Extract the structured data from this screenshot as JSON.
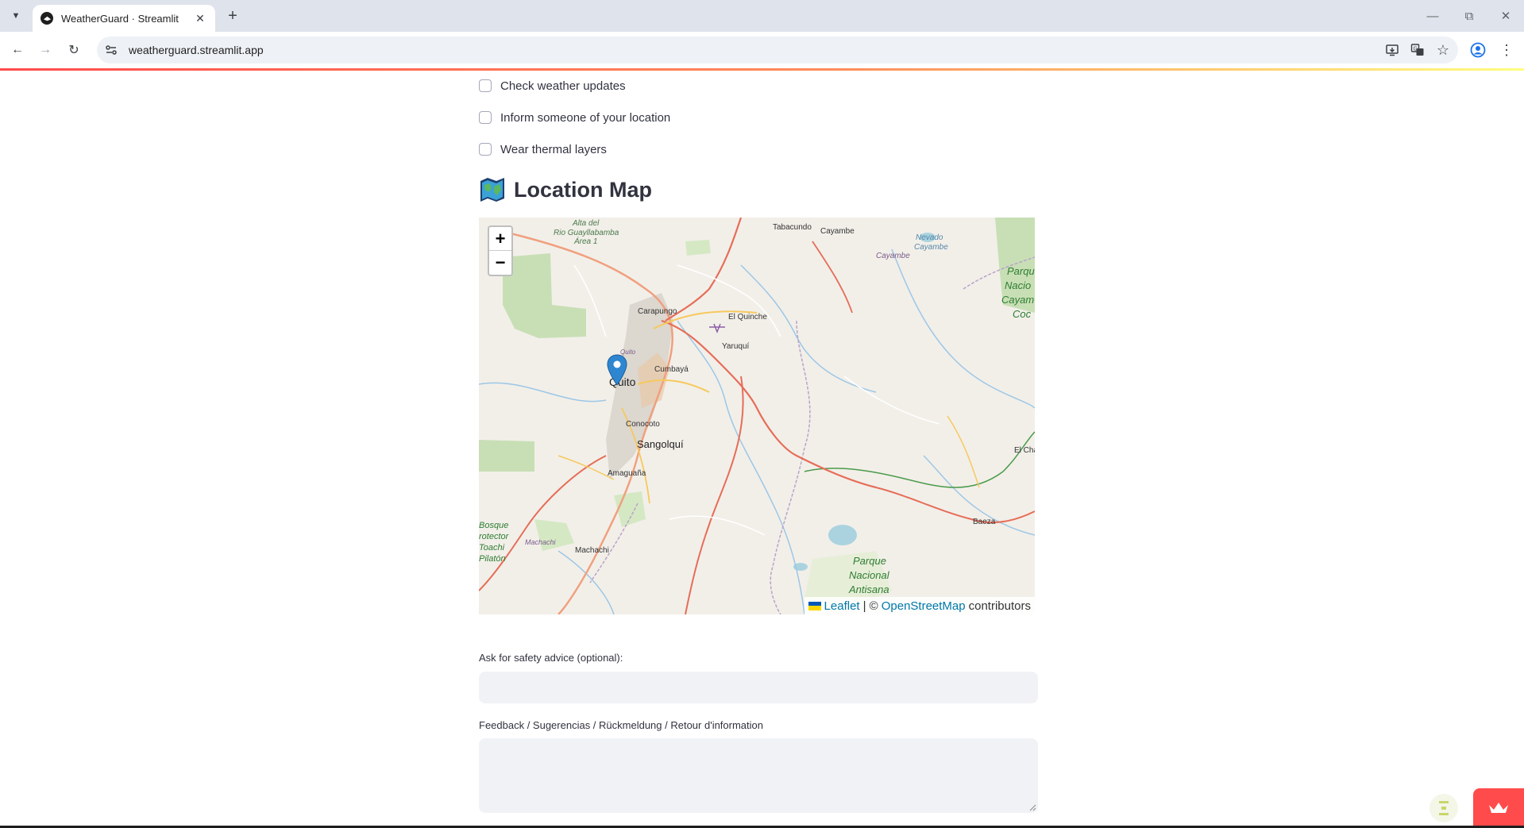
{
  "browser": {
    "tab_title": "WeatherGuard · Streamlit",
    "url": "weatherguard.streamlit.app"
  },
  "checklist": [
    {
      "label": "Check weather updates",
      "checked": false
    },
    {
      "label": "Inform someone of your location",
      "checked": false
    },
    {
      "label": "Wear thermal layers",
      "checked": false
    }
  ],
  "section": {
    "title": "Location Map",
    "icon": "world-map-icon"
  },
  "map": {
    "zoom_in": "+",
    "zoom_out": "−",
    "marker_place": "Quito",
    "places": [
      "Alta del",
      "Rio Guayllabamba",
      "Área 1",
      "Tabacundo",
      "Cayambe",
      "Nevado",
      "Cayambe",
      "Cayambe",
      "Parque",
      "Nacio",
      "Cayam",
      "Coc",
      "Carapungo",
      "El Quinche",
      "Yaruquí",
      "Quito",
      "Cumbayá",
      "Quito",
      "Conocoto",
      "Sangolquí",
      "Amaguaña",
      "El Cha",
      "Bosque",
      "rotector",
      "Toachi",
      "Pilatón",
      "Machachi",
      "Machachi",
      "Baeza",
      "Parque",
      "Nacional",
      "Antisana"
    ],
    "attribution": {
      "leaflet": "Leaflet",
      "separator": "| ©",
      "osm": "OpenStreetMap",
      "suffix": "contributors"
    }
  },
  "form": {
    "safety_label": "Ask for safety advice (optional):",
    "safety_value": "",
    "feedback_label": "Feedback / Sugerencias / Rückmeldung / Retour d'information",
    "feedback_value": ""
  },
  "colors": {
    "accent": "#ff4b4b",
    "input_bg": "#f0f2f6",
    "text": "#31333f",
    "link": "#0078a8"
  }
}
